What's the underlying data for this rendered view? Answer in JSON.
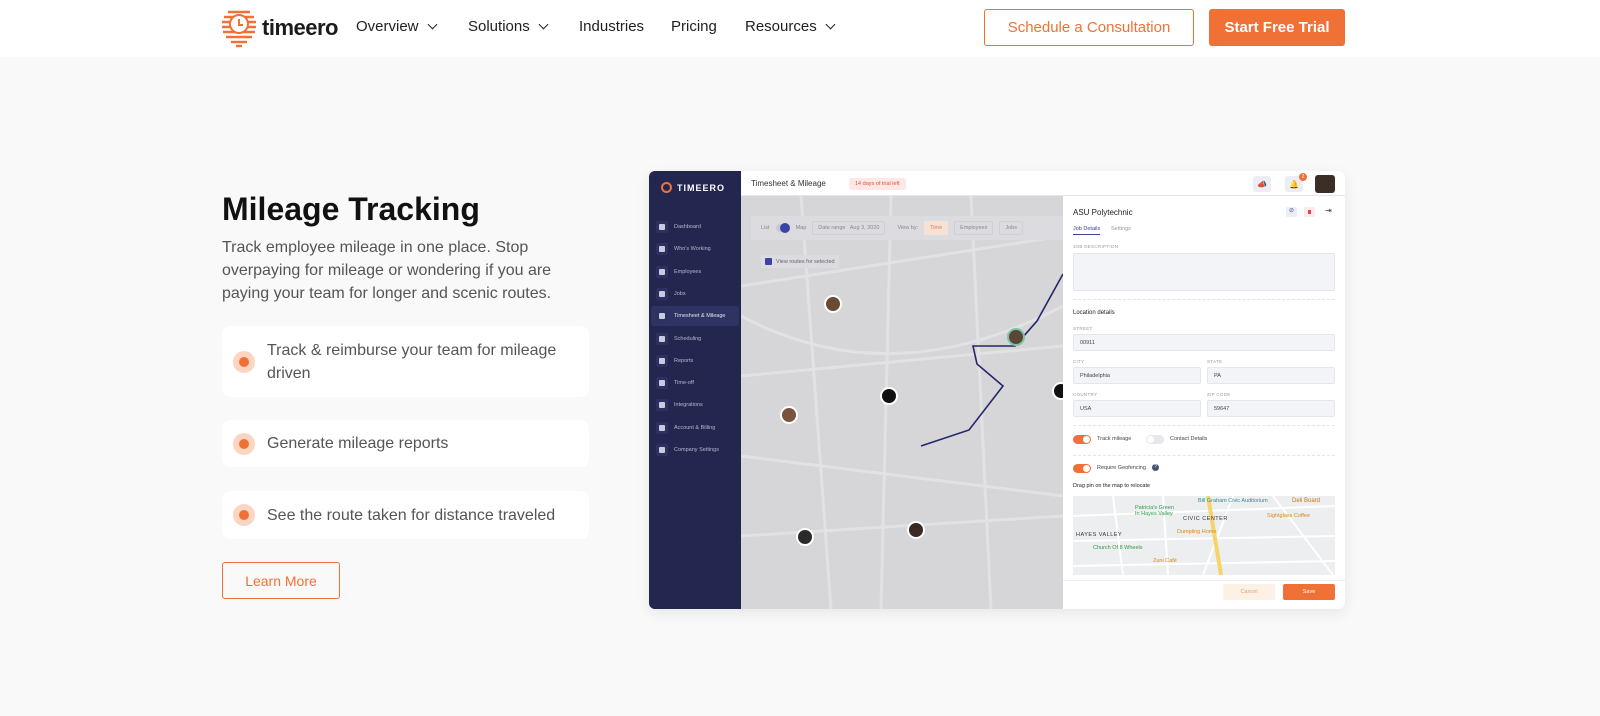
{
  "header": {
    "brand": "timeero",
    "nav": [
      {
        "label": "Overview",
        "dropdown": true
      },
      {
        "label": "Solutions",
        "dropdown": true
      },
      {
        "label": "Industries",
        "dropdown": false
      },
      {
        "label": "Pricing",
        "dropdown": false
      },
      {
        "label": "Resources",
        "dropdown": true
      }
    ],
    "consult_label": "Schedule a Consultation",
    "trial_label": "Start Free Trial"
  },
  "hero": {
    "title": "Mileage Tracking",
    "description": "Track employee mileage in one place. Stop overpaying for mileage or wondering if you are paying your team for longer and scenic routes.",
    "features": [
      "Track & reimburse your team for mileage driven",
      "Generate mileage reports",
      "See the route taken for distance traveled"
    ],
    "learn_more": "Learn More"
  },
  "app": {
    "brand": "TIMEERO",
    "sidebar": [
      "Dashboard",
      "Who's Working",
      "Employees",
      "Jobs",
      "Timesheet & Mileage",
      "Scheduling",
      "Reports",
      "Time-off",
      "Integrations",
      "Account & Billing",
      "Company Settings"
    ],
    "active": "Timesheet & Mileage",
    "page_title": "Timesheet & Mileage",
    "trial_badge": "14 days of trial left",
    "notification_count": "2",
    "filters": {
      "list": "List",
      "map": "Map",
      "date_range_label": "Date range",
      "date": "Aug 3, 2020",
      "view_by": "View by:",
      "views": [
        "Time",
        "Employees",
        "Jobs"
      ],
      "view_routes": "View routes for selected"
    },
    "panel": {
      "title": "ASU Polytechnic",
      "tabs": [
        "Job Details",
        "Settings"
      ],
      "job_description_label": "JOB DESCRIPTION",
      "location_heading": "Location details",
      "street_label": "STREET",
      "street": "00911",
      "city_label": "CITY",
      "city": "Philadelphia",
      "state_label": "STATE",
      "state": "PA",
      "country_label": "COUNTRY",
      "country": "USA",
      "zip_label": "ZIP CODE",
      "zip": "59647",
      "track_mileage": "Track mileage",
      "contact_details": "Contact Details",
      "geofencing": "Require Geofencing",
      "drag_pin": "Drag pin on the map to relocate",
      "cancel": "Cancel",
      "save": "Save",
      "map_labels": [
        "Bill Graham Civic Auditorium",
        "Patricia's Green In Hayes Valley",
        "CIVIC CENTER",
        "HAYES VALLEY",
        "Dumpling Home",
        "Sightglass Coffee",
        "Church Of 8 Wheels",
        "Zuni Café",
        "Deli Board"
      ]
    }
  },
  "colors": {
    "accent": "#f07136",
    "sidebar": "#23264e",
    "route": "#23266a"
  }
}
